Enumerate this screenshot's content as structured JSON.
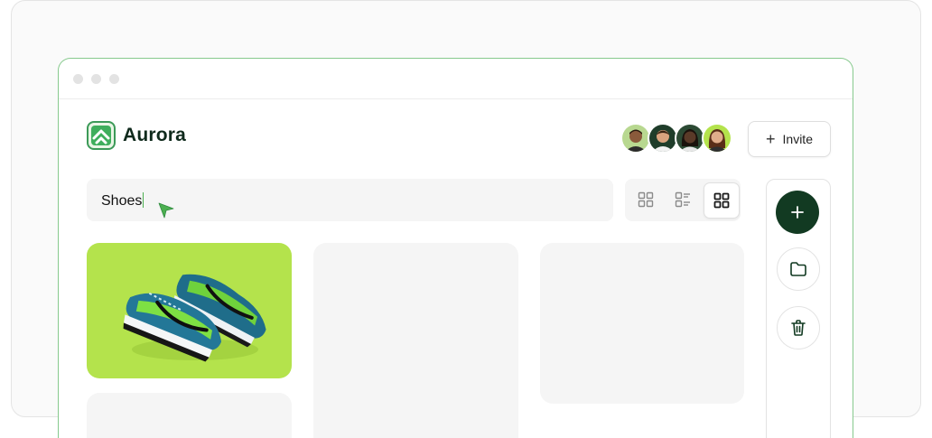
{
  "app": {
    "name": "Aurora"
  },
  "header": {
    "invite_label": "Invite",
    "avatars": [
      {
        "name": "user-1",
        "skin": "#8a5a3b",
        "hair": "#2a1a10",
        "bg": "#b8d890"
      },
      {
        "name": "user-2",
        "skin": "#d9a37e",
        "hair": "#3a2414",
        "bg": "#1f3d2a"
      },
      {
        "name": "user-3",
        "skin": "#5a3a28",
        "hair": "#1a120c",
        "bg": "#2c4a34"
      },
      {
        "name": "user-4",
        "skin": "#e0ad8a",
        "hair": "#5a2e18",
        "bg": "#b4e34c"
      }
    ]
  },
  "search": {
    "value": "Shoes"
  },
  "view_toggle": {
    "options": [
      "grid-small",
      "list",
      "grid-large"
    ],
    "selected": "grid-large"
  },
  "sidebar": {
    "buttons": [
      "add",
      "folder",
      "trash"
    ]
  },
  "colors": {
    "brand": "#123a22",
    "accent": "#4caf50",
    "product_bg": "#b4e34c"
  }
}
